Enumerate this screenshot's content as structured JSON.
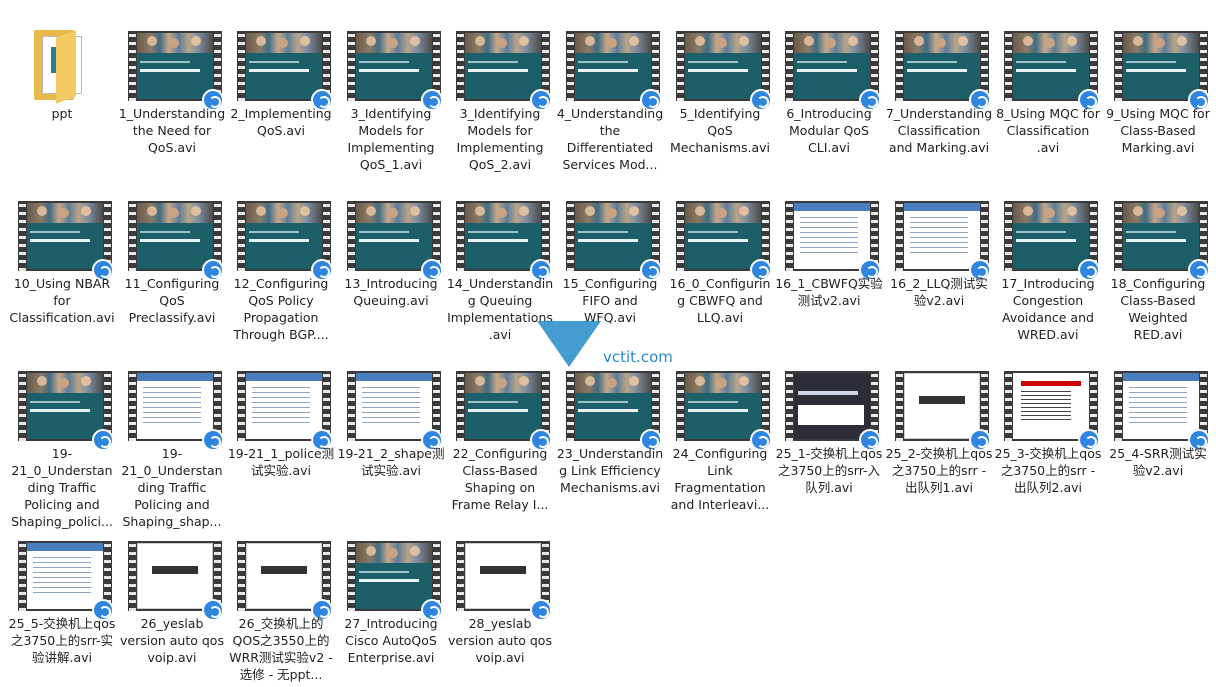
{
  "watermark": {
    "text": "vctit.com"
  },
  "files": [
    {
      "name": "ppt",
      "kind": "folder"
    },
    {
      "name": "1_Understanding the Need for QoS.avi",
      "kind": "cls"
    },
    {
      "name": "2_Implementing QoS.avi",
      "kind": "cls"
    },
    {
      "name": "3_Identifying Models for Implementing QoS_1.avi",
      "kind": "cls"
    },
    {
      "name": "3_Identifying Models for Implementing QoS_2.avi",
      "kind": "cls"
    },
    {
      "name": "4_Understanding the Differentiated Services Mod...",
      "kind": "cls"
    },
    {
      "name": "5_Identifying QoS Mechanisms.avi",
      "kind": "cls"
    },
    {
      "name": "6_Introducing Modular QoS CLI.avi",
      "kind": "cls"
    },
    {
      "name": "7_Understanding Classification and Marking.avi",
      "kind": "cls"
    },
    {
      "name": "8_Using MQC for Classification .avi",
      "kind": "cls"
    },
    {
      "name": "9_Using MQC for Class-Based Marking.avi",
      "kind": "cls"
    },
    {
      "name": "10_Using NBAR for Classification.avi",
      "kind": "cls"
    },
    {
      "name": "11_Configuring QoS Preclassify.avi",
      "kind": "cls"
    },
    {
      "name": "12_Configuring QoS Policy Propagation Through BGP....",
      "kind": "cls"
    },
    {
      "name": "13_Introducing Queuing.avi",
      "kind": "cls"
    },
    {
      "name": "14_Understanding Queuing Implementations.avi",
      "kind": "cls"
    },
    {
      "name": "15_Configuring FIFO and WFQ.avi",
      "kind": "cls"
    },
    {
      "name": "16_0_Configuring CBWFQ and LLQ.avi",
      "kind": "cls"
    },
    {
      "name": "16_1_CBWFQ实验测试v2.avi",
      "kind": "sld"
    },
    {
      "name": "16_2_LLQ测试实验v2.avi",
      "kind": "sld"
    },
    {
      "name": "17_Introducing Congestion Avoidance and WRED.avi",
      "kind": "cls"
    },
    {
      "name": "18_Configuring Class-Based Weighted RED.avi",
      "kind": "cls"
    },
    {
      "name": "19-21_0_Understanding Traffic Policing and Shaping_polici...",
      "kind": "cls"
    },
    {
      "name": "19-21_0_Understanding Traffic Policing and Shaping_shap...",
      "kind": "sld"
    },
    {
      "name": "19-21_1_police测试实验.avi",
      "kind": "sld"
    },
    {
      "name": "19-21_2_shape测试实验.avi",
      "kind": "sld"
    },
    {
      "name": "22_Configuring Class-Based Shaping on Frame Relay I...",
      "kind": "cls"
    },
    {
      "name": "23_Understanding Link Efficiency Mechanisms.avi",
      "kind": "cls"
    },
    {
      "name": "24_Configuring Link Fragmentation and Interleavi...",
      "kind": "cls"
    },
    {
      "name": "25_1-交换机上qos之3750上的srr-入队列.avi",
      "kind": "dark"
    },
    {
      "name": "25_2-交换机上qos之3750上的srr - 出队列1.avi",
      "kind": "big"
    },
    {
      "name": "25_3-交换机上qos之3750上的srr - 出队列2.avi",
      "kind": "red"
    },
    {
      "name": "25_4-SRR测试实验v2.avi",
      "kind": "sld"
    },
    {
      "name": "25_5-交换机上qos之3750上的srr-实验讲解.avi",
      "kind": "sld"
    },
    {
      "name": "26_yeslab version auto qos voip.avi",
      "kind": "big"
    },
    {
      "name": "26_交换机上的QOS之3550上的WRR测试实验v2 - 选修 - 无ppt...",
      "kind": "big"
    },
    {
      "name": "27_Introducing Cisco AutoQoS Enterprise.avi",
      "kind": "cls"
    },
    {
      "name": "28_yeslab version auto qos voip.avi",
      "kind": "big"
    }
  ]
}
